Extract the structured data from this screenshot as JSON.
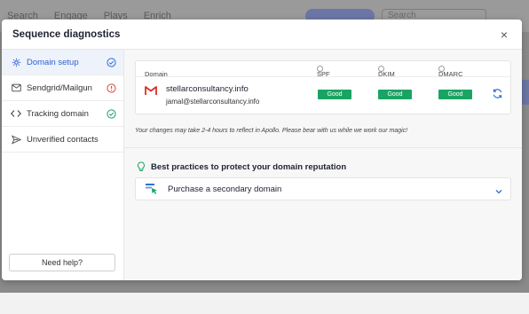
{
  "background": {
    "nav_items": [
      "Search",
      "Engage",
      "Plays",
      "Enrich"
    ],
    "search_placeholder": "Search"
  },
  "modal": {
    "title": "Sequence diagnostics",
    "close_label": "×"
  },
  "sidebar": {
    "items": [
      {
        "label": "Domain setup",
        "icon": "gear-icon",
        "status": "check-circle-icon",
        "status_color": "#2f6fd6",
        "active": true
      },
      {
        "label": "Sendgrid/Mailgun",
        "icon": "mail-icon",
        "status": "alert-circle-icon",
        "status_color": "#e2483d",
        "active": false
      },
      {
        "label": "Tracking domain",
        "icon": "code-icon",
        "status": "check-circle-icon",
        "status_color": "#1aa463",
        "active": false
      },
      {
        "label": "Unverified contacts",
        "icon": "send-icon",
        "status": "",
        "active": false
      }
    ],
    "help_label": "Need help?"
  },
  "domain_table": {
    "headers": {
      "domain": "Domain",
      "spf": "SPF",
      "dkim": "DKIM",
      "dmarc": "DMARC"
    },
    "row": {
      "domain": "stellarconsultancy.info",
      "email": "jamal@stellarconsultancy.info",
      "spf": "Good",
      "dkim": "Good",
      "dmarc": "Good"
    },
    "note": "Your changes may take 2-4 hours to reflect in Apollo. Please bear with us while we work our magic!"
  },
  "best_practices": {
    "title": "Best practices to protect your domain reputation",
    "items": [
      {
        "label": "Purchase a secondary domain"
      }
    ]
  },
  "colors": {
    "accent": "#2f5fd0",
    "good": "#1aa463",
    "error": "#e2483d"
  }
}
